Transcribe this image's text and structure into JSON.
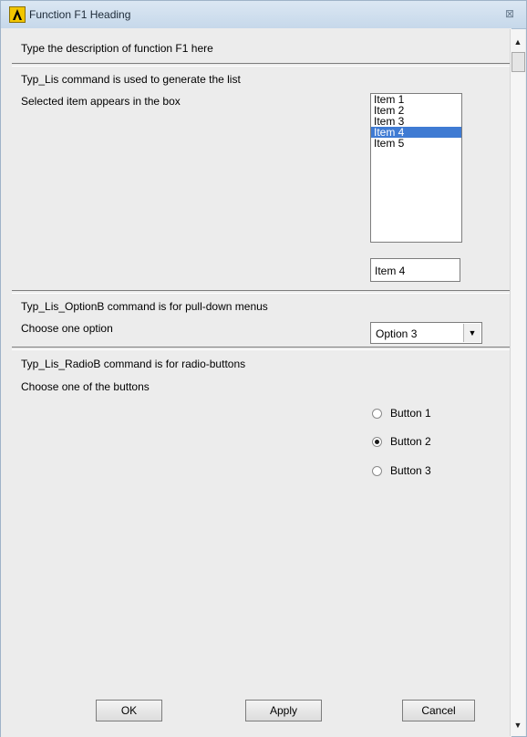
{
  "window": {
    "title": "Function F1 Heading",
    "close_glyph": "⊠",
    "icon": "ansys-logo-icon"
  },
  "description": "Type the description of function F1 here",
  "list_section": {
    "heading": "Typ_Lis command is used to generate the list",
    "subtext": "Selected item appears in the box",
    "items": [
      "Item 1",
      "Item 2",
      "Item 3",
      "Item 4",
      "Item 5"
    ],
    "selected_index": 3,
    "selected_value": "Item 4"
  },
  "option_section": {
    "heading": "Typ_Lis_OptionB command is for pull-down menus",
    "subtext": "Choose one option",
    "selected_option": "Option 3"
  },
  "radio_section": {
    "heading": "Typ_Lis_RadioB command is for radio-buttons",
    "subtext": "Choose one of the buttons",
    "buttons": [
      "Button 1",
      "Button 2",
      "Button 3"
    ],
    "checked_index": 1
  },
  "footer": {
    "ok_label": "OK",
    "apply_label": "Apply",
    "cancel_label": "Cancel"
  },
  "colors": {
    "selection": "#3f7bd3",
    "titlebar": "#c6d8ea",
    "dialog_bg": "#ececec"
  }
}
